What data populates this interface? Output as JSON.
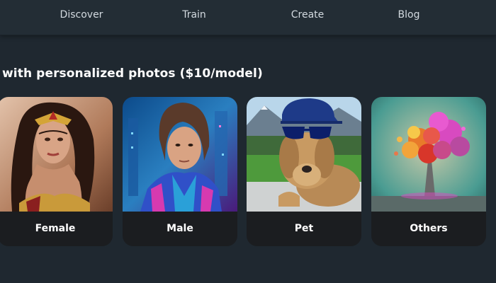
{
  "nav": {
    "items": [
      {
        "label": "Discover"
      },
      {
        "label": "Train"
      },
      {
        "label": "Create"
      },
      {
        "label": "Blog"
      }
    ]
  },
  "main": {
    "headline": "with personalized photos ($10/model)",
    "categories": [
      {
        "label": "Female",
        "image": "woman-portrait-image"
      },
      {
        "label": "Male",
        "image": "man-neon-portrait-image"
      },
      {
        "label": "Pet",
        "image": "dog-with-sunglasses-image"
      },
      {
        "label": "Others",
        "image": "colorful-explosion-image"
      }
    ]
  },
  "colors": {
    "background": "#1f2830",
    "nav_background": "#232d35",
    "card_background": "#1b1d20",
    "text": "#ffffff",
    "nav_text": "#d3dae0"
  }
}
